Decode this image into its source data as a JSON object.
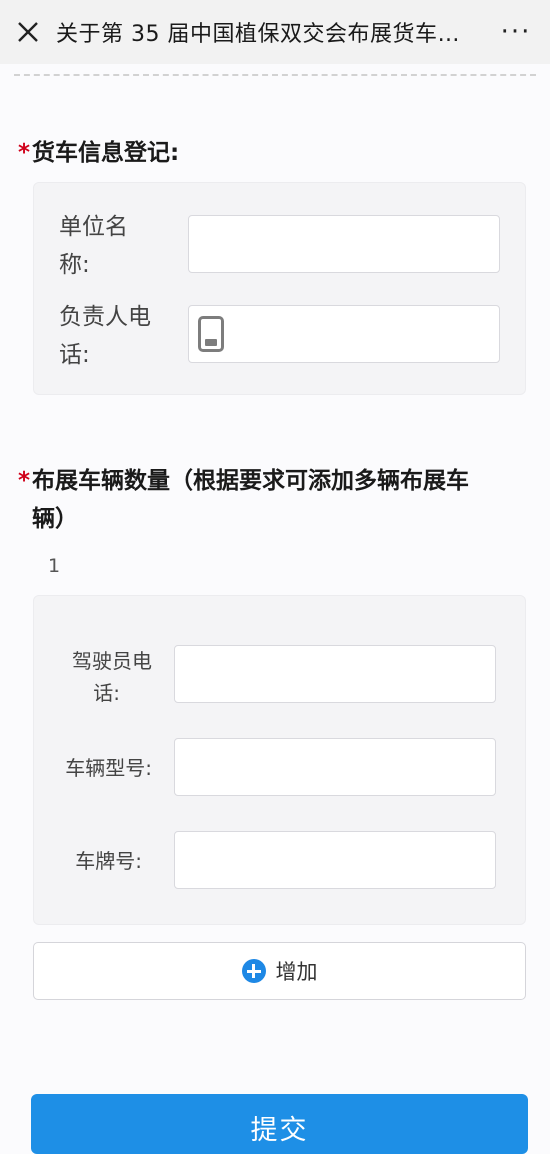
{
  "header": {
    "title": "关于第 35 届中国植保双交会布展货车…",
    "more_label": "···"
  },
  "section1": {
    "required_mark": "*",
    "title": "货车信息登记:",
    "unit_label_line1": "单位名",
    "unit_label_line2": "称:",
    "unit_value": "",
    "phone_label_line1": "负责人电",
    "phone_label_line2": "话:",
    "phone_value": ""
  },
  "section2": {
    "required_mark": "*",
    "title_line1": "布展车辆数量（根据要求可添加多辆布展车",
    "title_line2": "辆）",
    "row_index": "1",
    "driver_label_line1": "驾驶员电",
    "driver_label_line2": "话:",
    "driver_value": "",
    "model_label": "车辆型号:",
    "model_value": "",
    "plate_label": "车牌号:",
    "plate_value": "",
    "add_label": "增加"
  },
  "submit_label": "提交",
  "colors": {
    "accent": "#1e8fe6",
    "required": "#d0021b",
    "plus_icon": "#1e88e5"
  }
}
